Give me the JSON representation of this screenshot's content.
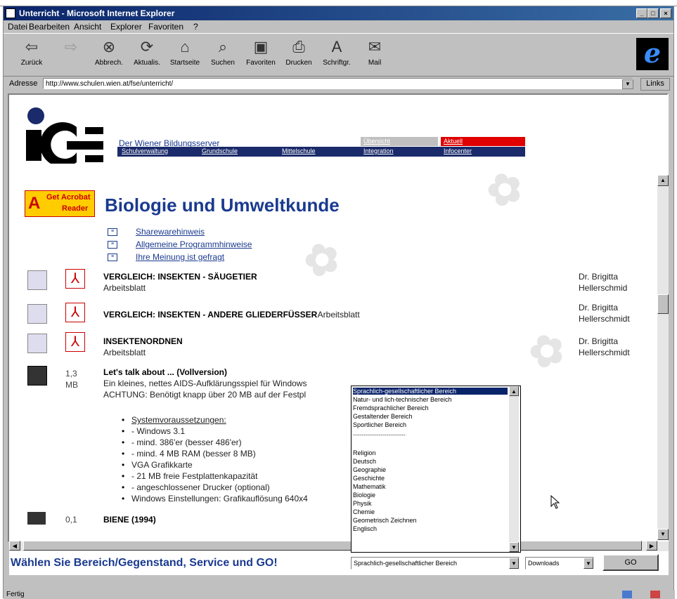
{
  "window": {
    "title": "Unterricht - Microsoft Internet Explorer",
    "minimize": "_",
    "maximize": "□",
    "close": "×"
  },
  "menu": [
    "Datei",
    "Bearbeiten",
    "Ansicht",
    "Explorer",
    "Favoriten",
    "?"
  ],
  "toolbar": [
    {
      "label": "Zurück",
      "icon": "back-arrow-icon",
      "glyph": "⇦"
    },
    {
      "label": "Vorwärts",
      "icon": "forward-arrow-icon",
      "glyph": "⇨"
    },
    {
      "label": "Abbrech.",
      "icon": "stop-icon",
      "glyph": "⊗"
    },
    {
      "label": "Aktualis.",
      "icon": "refresh-icon",
      "glyph": "⟳"
    },
    {
      "label": "Startseite",
      "icon": "home-icon",
      "glyph": "⌂"
    },
    {
      "label": "Suchen",
      "icon": "search-icon",
      "glyph": "⌕"
    },
    {
      "label": "Favoriten",
      "icon": "favorites-icon",
      "glyph": "▣"
    },
    {
      "label": "Drucken",
      "icon": "print-icon",
      "glyph": "⎙"
    },
    {
      "label": "Schriftgr.",
      "icon": "font-size-icon",
      "glyph": "A"
    },
    {
      "label": "Mail",
      "icon": "mail-icon",
      "glyph": "✉"
    }
  ],
  "address": {
    "label": "Adresse",
    "value": "http://www.schulen.wien.at/fse/unterricht/",
    "links": "Links"
  },
  "site": {
    "tagline": "Der Wiener Bildungsserver",
    "nav_row1": [
      {
        "label": "Übersicht",
        "color": "#c0c0c0",
        "text_color": "#fff"
      },
      {
        "label": "Aktuell",
        "color": "#ff0000",
        "text_color": "#fff"
      }
    ],
    "nav_row2": [
      "Schulverwaltung",
      "Grundschule",
      "Mittelschule",
      "Integration",
      "Infocenter"
    ]
  },
  "acrobat": {
    "line1": "Get Acrobat",
    "line2": "Reader"
  },
  "heading": "Biologie und Umweltkunde",
  "info_links": [
    "Sharewarehinweis",
    "Allgemeine Programmhinweise",
    "Ihre Meinung ist gefragt"
  ],
  "entries": [
    {
      "title": "VERGLEICH: INSEKTEN - SÄUGETIER",
      "sub": "Arbeitsblatt",
      "author1": "Dr. Brigitta",
      "author2": "Hellerschmid"
    },
    {
      "title": "VERGLEICH: INSEKTEN - ANDERE GLIEDERFÜSSER",
      "sub": " - Arbeitsblatt",
      "author1": "Dr. Brigitta",
      "author2": "Hellerschmidt"
    },
    {
      "title": "INSEKTENORDNEN",
      "sub": "Arbeitsblatt",
      "author1": "Dr. Brigitta",
      "author2": "Hellerschmidt"
    }
  ],
  "download": {
    "size1": "1,3",
    "size2": "MB",
    "title": "Let's talk about ... (Vollversion)",
    "desc1": "Ein kleines, nettes AIDS-Aufklärungsspiel für Windows",
    "desc2": "ACHTUNG: Benötigt knapp über 20 MB auf der Festpl",
    "sysreq_label": "Systemvoraussetzungen:",
    "sysreq": [
      "- Windows 3.1",
      "- mind. 386'er (besser 486'er)",
      "- mind. 4 MB RAM (besser 8 MB)",
      "VGA Grafikkarte",
      "- 21 MB freie Festplattenkapazität",
      "- angeschlossener Drucker (optional)",
      "Windows Einstellungen: Grafikauflösung 640x4"
    ]
  },
  "biene": {
    "size": "0,1",
    "title": "BIENE (1994)"
  },
  "dropdown_options": {
    "group1": [
      "Sprachlich-gesellschaftlicher Bereich",
      "Natur- und lich-technischer Bereich",
      "Fremdsprachlicher Bereich",
      "Gestaltender Bereich",
      "Sportlicher Bereich"
    ],
    "separator": "-------------------------",
    "group2": [
      "Religion",
      "Deutsch",
      "Geographie",
      "Geschichte",
      "Mathematik",
      "Biologie",
      "Physik",
      "Chemie",
      "Geometrisch Zeichnen",
      "Englisch"
    ]
  },
  "footer": {
    "prompt": "Wählen Sie Bereich/Gegenstand, Service und GO!",
    "bereich_selected": "Sprachlich-gesellschaftlicher Bereich",
    "service_selected": "Downloads",
    "go": "GO"
  },
  "status": {
    "text": "Fertig"
  }
}
